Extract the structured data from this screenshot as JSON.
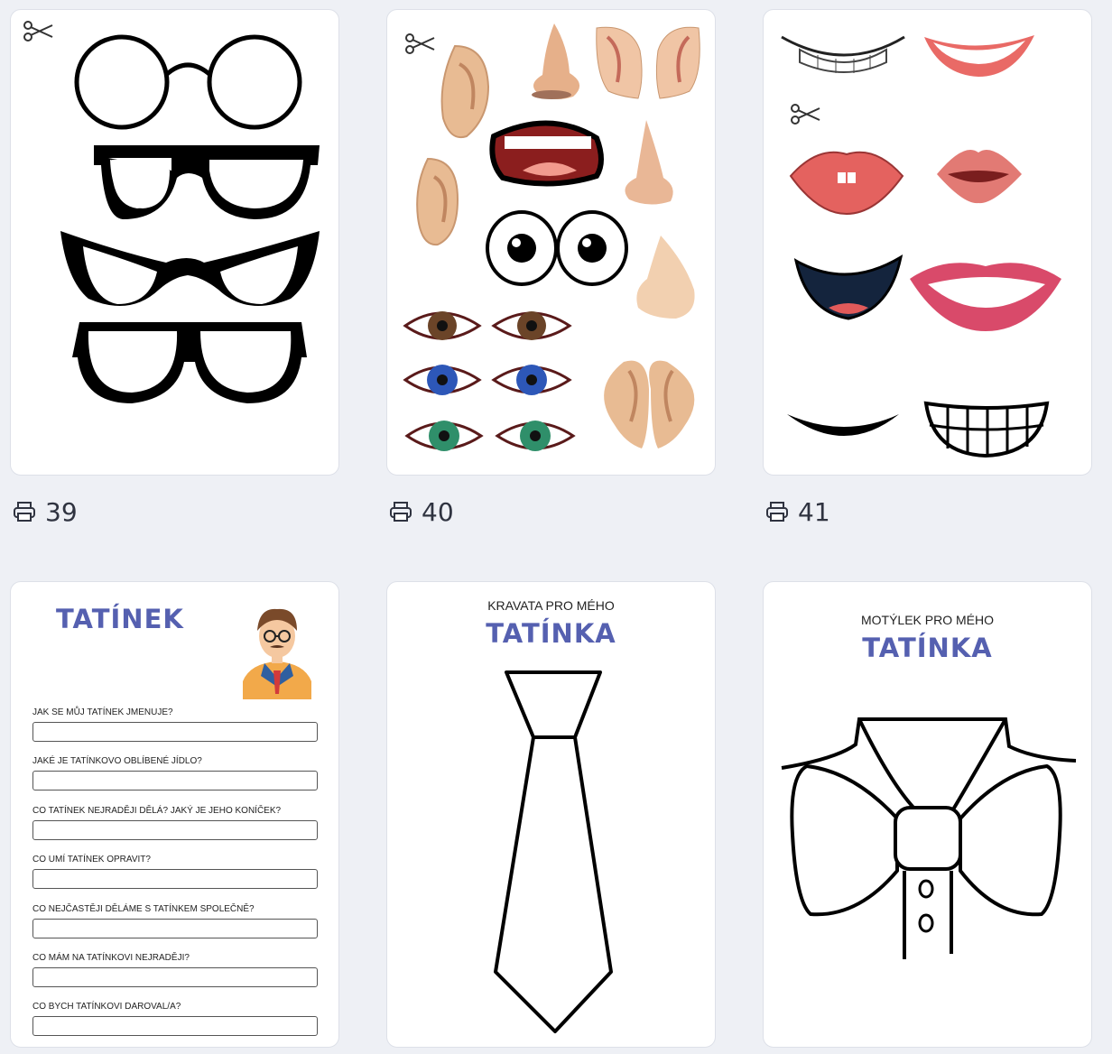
{
  "cards": [
    {
      "id": "glasses",
      "print_count": "39",
      "icon": "printer-icon"
    },
    {
      "id": "face-parts",
      "print_count": "40",
      "icon": "printer-icon"
    },
    {
      "id": "mouths",
      "print_count": "41",
      "icon": "printer-icon"
    }
  ],
  "dad_sheet": {
    "title": "TATÍNEK",
    "questions": [
      "JAK SE MŮJ TATÍNEK JMENUJE?",
      "JAKÉ JE TATÍNKOVO OBLÍBENÉ JÍDLO?",
      "CO TATÍNEK NEJRADĚJI DĚLÁ? JAKÝ JE JEHO KONÍČEK?",
      "CO UMÍ TATÍNEK OPRAVIT?",
      "CO NEJČASTĚJI DĚLÁME S TATÍNKEM SPOLEČNĚ?",
      "CO MÁM NA TATÍNKOVI NEJRADĚJI?",
      "CO BYCH TATÍNKOVI DAROVAL/A?"
    ]
  },
  "tie_sheet": {
    "kicker": "KRAVATA PRO MÉHO",
    "title": "TATÍNKA"
  },
  "bowtie_sheet": {
    "kicker": "MOTÝLEK PRO MÉHO",
    "title": "TATÍNKA"
  },
  "colors": {
    "title_blue": "#5560b0",
    "background": "#eef0f5",
    "card": "#ffffff"
  }
}
